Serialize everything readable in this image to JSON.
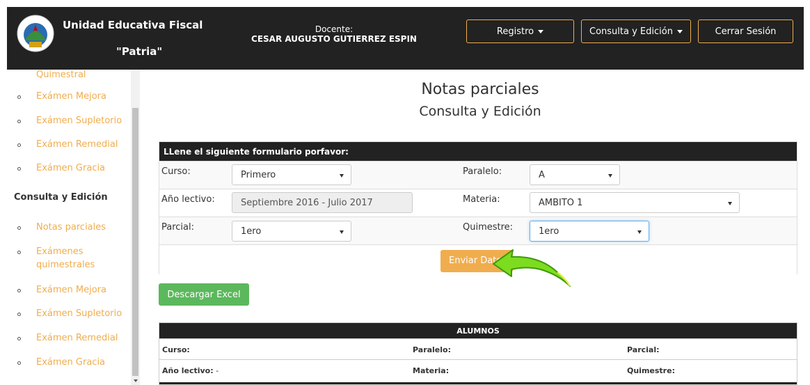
{
  "navbar": {
    "brand_line1": "Unidad Educativa Fiscal",
    "brand_line2": "\"Patria\"",
    "docente_label": "Docente:",
    "docente_name": "CESAR AUGUSTO GUTIERREZ ESPIN",
    "btn_registro": "Registro",
    "btn_consulta": "Consulta y Edición",
    "btn_logout": "Cerrar Sesión",
    "accent": "#f0ad4e"
  },
  "sidebar": {
    "top_cut": "Quimestral",
    "group1": [
      "Exámen Mejora",
      "Exámen Supletorio",
      "Exámen Remedial",
      "Exámen Gracia"
    ],
    "heading": "Consulta y Edición",
    "group2": [
      "Notas parciales",
      "Exámenes quimestrales",
      "Exámen Mejora",
      "Exámen Supletorio",
      "Exámen Remedial",
      "Exámen Gracia"
    ]
  },
  "page": {
    "title": "Notas parciales",
    "subtitle": "Consulta y Edición"
  },
  "form": {
    "heading": "LLene el siguiente formulario porfavor:",
    "curso_label": "Curso:",
    "curso_value": "Primero",
    "paralelo_label": "Paralelo:",
    "paralelo_value": "A",
    "anio_label": "Año lectivo:",
    "anio_value": "Septiembre 2016 - Julio 2017",
    "materia_label": "Materia:",
    "materia_value": "AMBITO 1",
    "parcial_label": "Parcial:",
    "parcial_value": "1ero",
    "quimestre_label": "Quimestre:",
    "quimestre_value": "1ero",
    "send_label": "Enviar Datos"
  },
  "excel_button": "Descargar Excel",
  "alumnos": {
    "heading": "ALUMNOS",
    "curso": "Curso:",
    "paralelo": "Paralelo:",
    "parcial": "Parcial:",
    "anio": "Año lectivo:",
    "anio_value": "-",
    "materia": "Materia:",
    "quimestre": "Quimestre:"
  },
  "colors": {
    "dark": "#222222",
    "warning": "#f0ad4e",
    "success": "#5cb85c",
    "pointer_arrow": "#7ddc1f"
  }
}
